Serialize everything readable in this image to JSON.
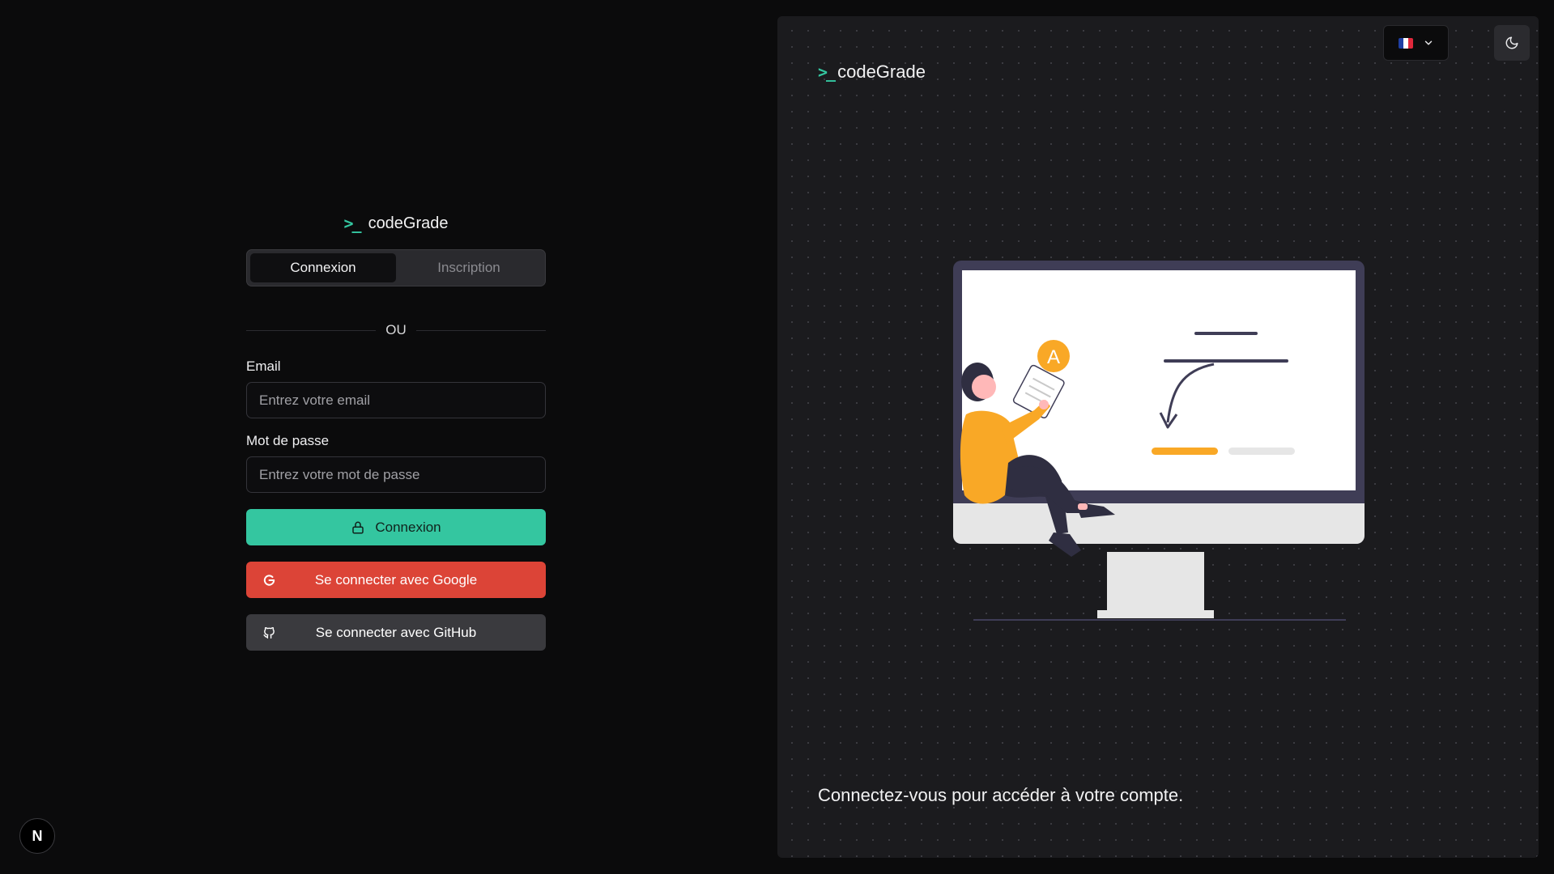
{
  "brand": {
    "name": "codeGrade",
    "mark": ">_"
  },
  "tabs": [
    {
      "label": "Connexion",
      "active": true
    },
    {
      "label": "Inscription",
      "active": false
    }
  ],
  "divider_text": "OU",
  "email": {
    "label": "Email",
    "placeholder": "Entrez votre email",
    "value": ""
  },
  "password": {
    "label": "Mot de passe",
    "placeholder": "Entrez votre mot de passe",
    "value": ""
  },
  "buttons": {
    "login": "Connexion",
    "google": "Se connecter avec Google",
    "github": "Se connecter avec GitHub"
  },
  "badge": "N",
  "panel": {
    "brand": "codeGrade",
    "language": {
      "selected": "fr",
      "flag_colors": [
        "#1f3fa3",
        "#ffffff",
        "#e0283b"
      ]
    },
    "caption": "Connectez-vous pour accéder à votre compte.",
    "illustration_badge_letter": "A"
  },
  "colors": {
    "accent": "#34c6a0",
    "google": "#dc4437",
    "github": "#3a3a3e",
    "illustration_highlight": "#f9a826"
  },
  "icons": [
    "lock-icon",
    "google-icon",
    "github-icon",
    "chevron-down-icon",
    "moon-icon",
    "brand-prompt-icon"
  ]
}
